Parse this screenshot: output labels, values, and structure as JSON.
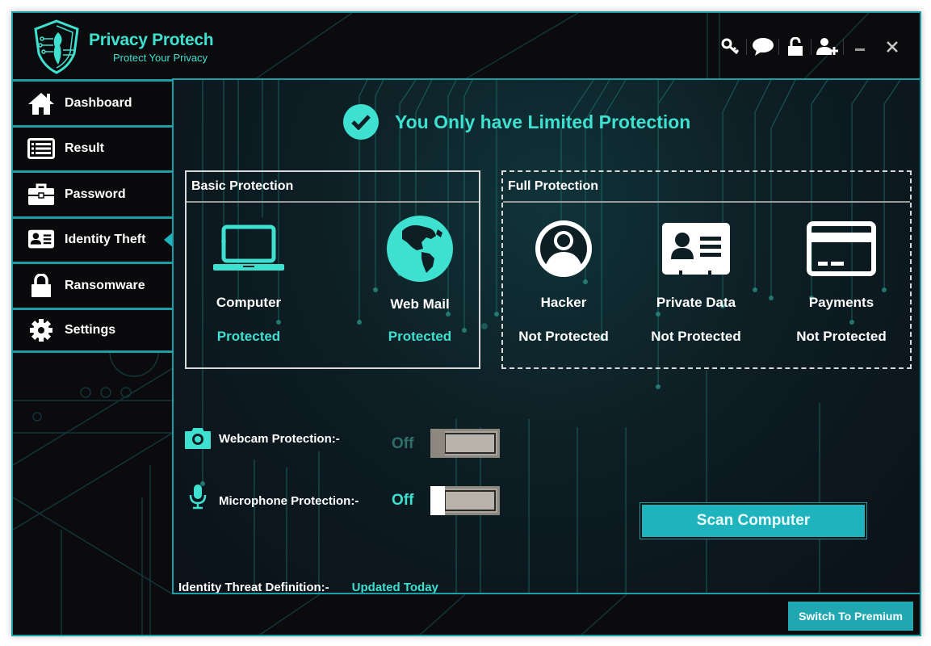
{
  "app": {
    "title": "Privacy Protech",
    "subtitle": "Protect Your Privacy",
    "accent_color": "#3ee0cf",
    "border_color": "#1c9ea6"
  },
  "header": {
    "icons": [
      {
        "name": "key-icon",
        "label": "License key"
      },
      {
        "name": "chat-icon",
        "label": "Support chat"
      },
      {
        "name": "unlock-icon",
        "label": "Unlock"
      },
      {
        "name": "add-user-icon",
        "label": "Add user"
      },
      {
        "name": "minimize-icon",
        "label": "Minimize"
      },
      {
        "name": "close-icon",
        "label": "Close"
      }
    ]
  },
  "sidebar": {
    "items": [
      {
        "label": "Dashboard",
        "icon": "home-icon",
        "active": false
      },
      {
        "label": "Result",
        "icon": "list-icon",
        "active": false
      },
      {
        "label": "Password",
        "icon": "briefcase-icon",
        "active": false
      },
      {
        "label": "Identity Theft",
        "icon": "id-card-icon",
        "active": true
      },
      {
        "label": "Ransomware",
        "icon": "lock-icon",
        "active": false
      },
      {
        "label": "Settings",
        "icon": "gear-icon",
        "active": false
      }
    ]
  },
  "main": {
    "status_message": "You Only have Limited Protection",
    "basic": {
      "title": "Basic Protection",
      "features": [
        {
          "name": "Computer",
          "status": "Protected",
          "icon": "laptop-icon"
        },
        {
          "name": "Web Mail",
          "status": "Protected",
          "icon": "globe-icon"
        }
      ]
    },
    "full": {
      "title": "Full Protection",
      "features": [
        {
          "name": "Hacker",
          "status": "Not Protected",
          "icon": "user-circle-icon"
        },
        {
          "name": "Private Data",
          "status": "Not Protected",
          "icon": "id-card-icon"
        },
        {
          "name": "Payments",
          "status": "Not Protected",
          "icon": "credit-card-icon"
        }
      ]
    },
    "toggles": [
      {
        "label": "Webcam Protection:-",
        "state": "Off",
        "enabled": false
      },
      {
        "label": "Microphone Protection:-",
        "state": "Off",
        "enabled": false
      }
    ],
    "scan_button": "Scan Computer",
    "definition_label": "Identity Threat Definition:-",
    "definition_value": "Updated Today"
  },
  "footer": {
    "premium_button": "Switch To Premium"
  }
}
